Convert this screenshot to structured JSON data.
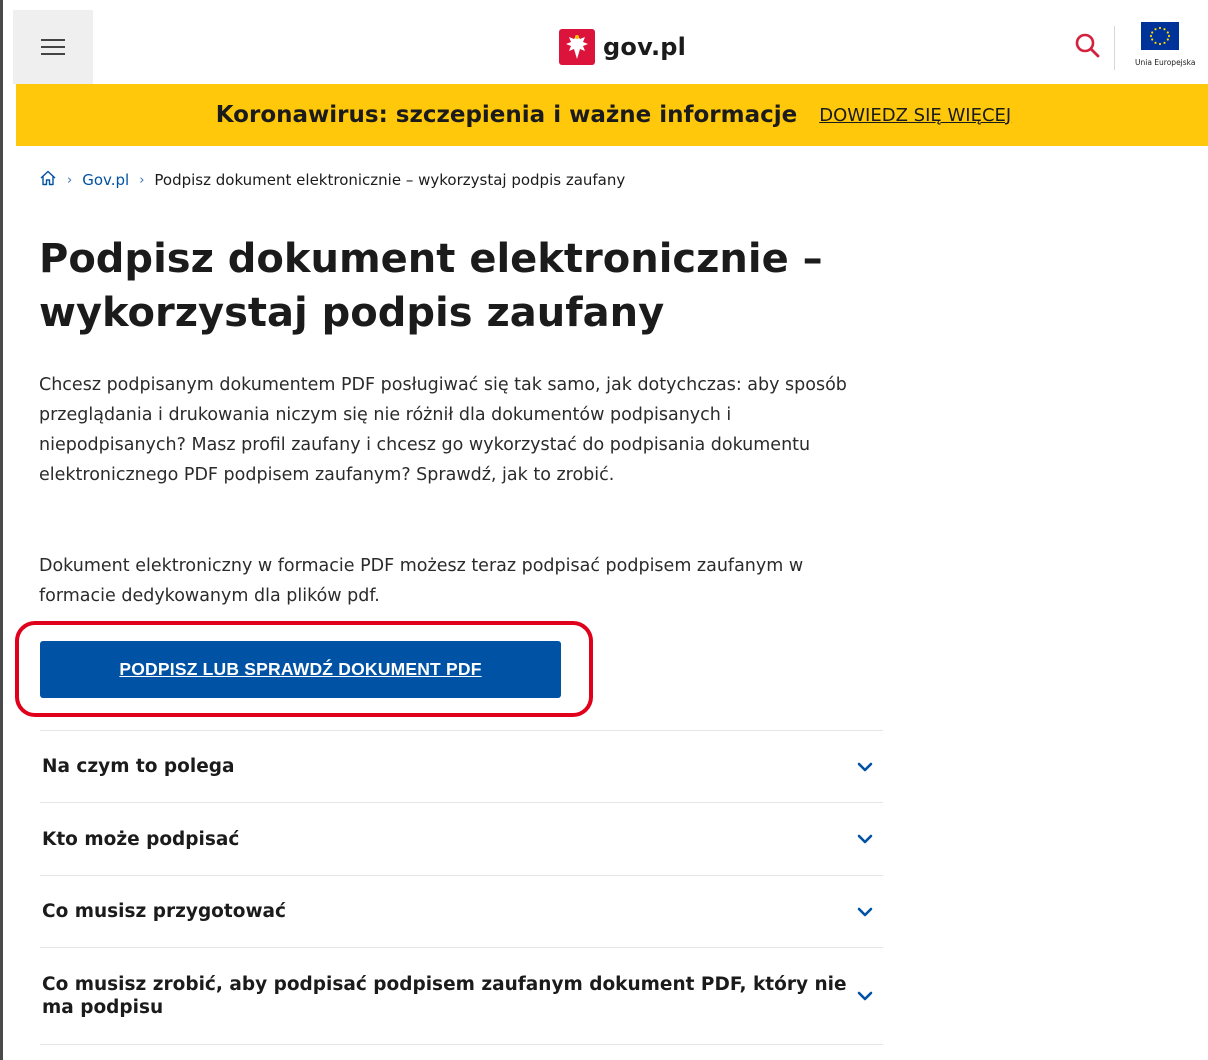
{
  "header": {
    "menu_icon": "hamburger-icon",
    "logo_text": "gov.pl",
    "search_icon": "search-icon",
    "eu_label": "Unia Europejska"
  },
  "banner": {
    "title": "Koronawirus: szczepienia i ważne informacje",
    "link": "DOWIEDZ SIĘ WIĘCEJ",
    "color": "#ffc80a"
  },
  "breadcrumb": {
    "home_icon": "home-icon",
    "items": [
      "Gov.pl",
      "Podpisz dokument elektronicznie – wykorzystaj podpis zaufany"
    ]
  },
  "main": {
    "title_line1": "Podpisz dokument elektronicznie –",
    "title_line2": "wykorzystaj podpis zaufany",
    "intro": "Chcesz podpisanym dokumentem PDF posługiwać się tak samo, jak dotychczas: aby sposób przeglądania i drukowania niczym się nie różnił dla dokumentów podpisanych i niepodpisanych? Masz profil zaufany i chcesz go wykorzystać do podpisania dokumentu elektronicznego PDF podpisem zaufanym? Sprawdź, jak to zrobić.",
    "intro2": "Dokument elektroniczny w formacie PDF możesz teraz podpisać podpisem zaufanym w formacie dedykowanym dla plików pdf.",
    "cta_label": "PODPISZ LUB SPRAWDŹ DOKUMENT PDF",
    "accent_color": "#0052a5",
    "highlight_color": "#e0001b"
  },
  "accordion": [
    {
      "label": "Na czym to polega"
    },
    {
      "label": "Kto może podpisać"
    },
    {
      "label": "Co musisz przygotować"
    },
    {
      "label": "Co musisz zrobić, aby podpisać podpisem zaufanym dokument PDF, który nie ma podpisu"
    }
  ]
}
